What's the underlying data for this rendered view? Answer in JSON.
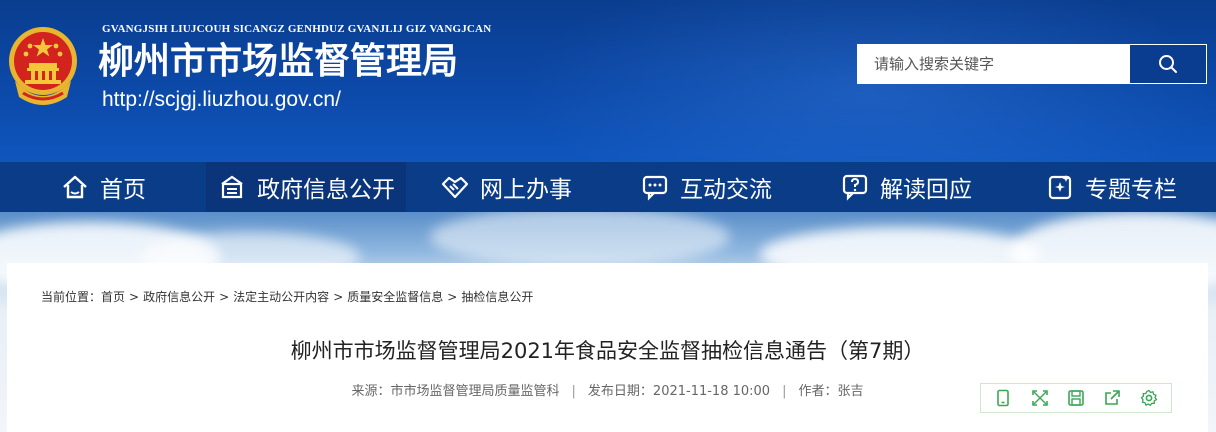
{
  "header": {
    "subtitle": "GVANGJSIH LIUJCOUH SICANGZ GENHDUZ GVANJLIJ GIZ VANGJCAN",
    "title": "柳州市市场监督管理局",
    "url": "http://scjgj.liuzhou.gov.cn/"
  },
  "search": {
    "placeholder": "请输入搜索关键字",
    "icon": "search-icon"
  },
  "nav": {
    "items": [
      {
        "label": "首页",
        "icon": "home-icon"
      },
      {
        "label": "政府信息公开",
        "icon": "info-public-icon"
      },
      {
        "label": "网上办事",
        "icon": "handshake-icon"
      },
      {
        "label": "互动交流",
        "icon": "chat-icon"
      },
      {
        "label": "解读回应",
        "icon": "question-bubble-icon"
      },
      {
        "label": "专题专栏",
        "icon": "sparkle-doc-icon"
      }
    ]
  },
  "breadcrumb": {
    "prefix": "当前位置：",
    "items": [
      "首页",
      "政府信息公开",
      "法定主动公开内容",
      "质量安全监督信息",
      "抽检信息公开"
    ],
    "separator": ">"
  },
  "article": {
    "title": "柳州市市场监督管理局2021年食品安全监督抽检信息通告（第7期）",
    "source_label": "来源：",
    "source": "市市场监督管理局质量监管科",
    "date_label": "发布日期：",
    "date": "2021-11-18 10:00",
    "author_label": "作者：",
    "author": "张吉"
  },
  "tools": [
    "phone-icon",
    "fullscreen-icon",
    "save-icon",
    "share-icon",
    "settings-icon"
  ],
  "colors": {
    "header_blue": "#0c49a8",
    "nav_blue": "#0b3c88",
    "tool_green": "#3aa655"
  }
}
